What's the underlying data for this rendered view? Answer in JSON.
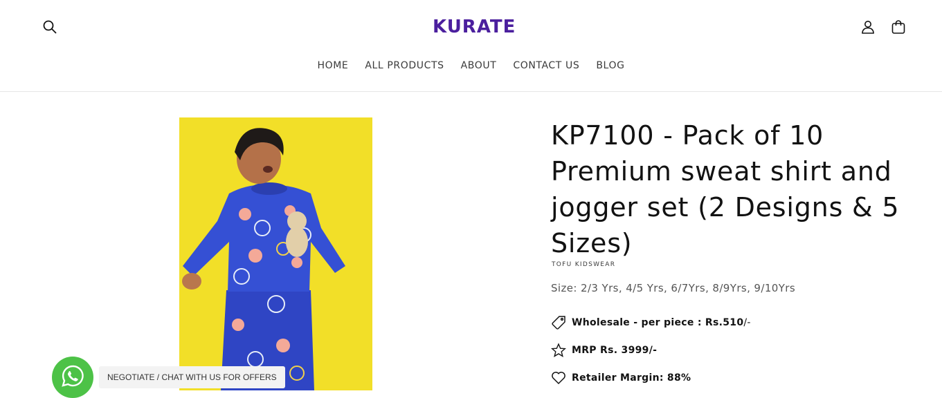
{
  "header": {
    "logo_text": "KURATE",
    "brand_color": "#4b1f9e",
    "icons": {
      "search": "search-icon",
      "account": "account-icon",
      "cart": "cart-icon"
    }
  },
  "nav": {
    "items": [
      "HOME",
      "ALL PRODUCTS",
      "ABOUT",
      "CONTACT US",
      "BLOG"
    ]
  },
  "product": {
    "title": "KP7100 - Pack of 10 Premium sweat shirt and jogger set (2 Designs & 5 Sizes)",
    "vendor": "TOFU KIDSWEAR",
    "size": "Size: 2/3 Yrs, 4/5 Yrs, 6/7Yrs, 8/9Yrs, 9/10Yrs",
    "features": {
      "wholesale_label": "Wholesale - per piece : ",
      "wholesale_price": "Rs.510",
      "wholesale_suffix": "/-",
      "mrp": "MRP Rs. 3999/-",
      "margin": "Retailer Margin: 88%"
    },
    "image_background": "#f2df28"
  },
  "chat": {
    "label": "NEGOTIATE / CHAT WITH US FOR OFFERS",
    "icon": "whatsapp-icon",
    "color": "#4dc247"
  }
}
